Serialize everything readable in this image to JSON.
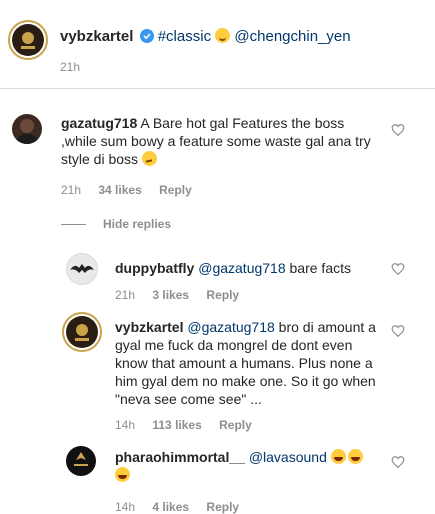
{
  "post": {
    "username": "vybzkartel",
    "caption_tag": "#classic",
    "caption_mention": "@chengchin_yen",
    "time": "21h"
  },
  "comment1": {
    "username": "gazatug718",
    "text": "A Bare hot gal Features the boss ,while sum bowy a feature some waste gal ana try style di boss",
    "time": "21h",
    "likes": "34 likes",
    "reply": "Reply",
    "hide_replies": "Hide replies"
  },
  "reply1": {
    "username": "duppybatfly",
    "mention": "@gazatug718",
    "text": "bare facts",
    "time": "21h",
    "likes": "3 likes",
    "reply": "Reply"
  },
  "reply2": {
    "username": "vybzkartel",
    "mention": "@gazatug718",
    "line1": "bro di amount a",
    "line2": "gyal me fuck da mongrel de dont even",
    "line3": "know that amount a humans. Plus none a",
    "line4": "him gyal dem no make one. So it go when",
    "line5": "\"neva see come see\" ...",
    "time": "14h",
    "likes": "113 likes",
    "reply": "Reply"
  },
  "reply3": {
    "username": "pharaohimmortal__",
    "mention": "@lavasound",
    "time": "14h",
    "likes": "4 likes",
    "reply": "Reply"
  }
}
